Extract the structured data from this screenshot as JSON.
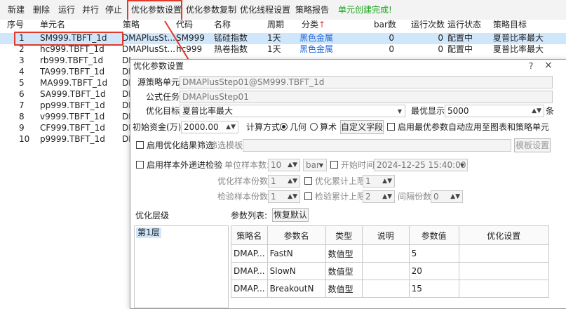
{
  "toolbar": {
    "items": [
      "新建",
      "删除",
      "运行",
      "并行",
      "停止",
      "优化参数设置",
      "优化参数复制",
      "优化线程设置",
      "策略报告"
    ],
    "status": "单元创建完成!"
  },
  "table": {
    "headers": [
      "序号",
      "单元名",
      "策略",
      "代码",
      "名称",
      "周期",
      "分类",
      "bar数",
      "运行次数",
      "运行状态",
      "策略目标"
    ],
    "header_mark": "↑",
    "rows": [
      {
        "no": "1",
        "name": "SM999.TBFT_1d",
        "strategy": "DMAPlusSt...",
        "code": "SM999",
        "cname": "锰硅指数",
        "period": "1天",
        "category": "黑色金属",
        "bars": "0",
        "runs": "0",
        "state": "配置中",
        "target": "夏普比率最大"
      },
      {
        "no": "2",
        "name": "hc999.TBFT_1d",
        "strategy": "DMAPlusSt...",
        "code": "hc999",
        "cname": "热卷指数",
        "period": "1天",
        "category": "黑色金属",
        "bars": "0",
        "runs": "0",
        "state": "配置中",
        "target": "夏普比率最大"
      },
      {
        "no": "3",
        "name": "rb999.TBFT_1d",
        "strategy": "DI"
      },
      {
        "no": "4",
        "name": "TA999.TBFT_1d",
        "strategy": "DI"
      },
      {
        "no": "5",
        "name": "MA999.TBFT_1d",
        "strategy": "DI"
      },
      {
        "no": "6",
        "name": "SA999.TBFT_1d",
        "strategy": "DI"
      },
      {
        "no": "7",
        "name": "pp999.TBFT_1d",
        "strategy": "DI"
      },
      {
        "no": "8",
        "name": "v9999.TBFT_1d",
        "strategy": "DI"
      },
      {
        "no": "9",
        "name": "CF999.TBFT_1d",
        "strategy": "DI"
      },
      {
        "no": "10",
        "name": "p9999.TBFT_1d",
        "strategy": "DI"
      }
    ]
  },
  "dialog": {
    "title": "优化参数设置",
    "help_icon": "?",
    "close_icon": "×",
    "source_label": "源策略单元:",
    "source_value": "DMAPlusStep01@SM999.TBFT_1d",
    "formula_label": "公式任务:",
    "formula_value": "DMAPlusStep01",
    "target_label": "优化目标:",
    "target_value": "夏普比率最大",
    "best_show_label": "最优显示:",
    "best_show_value": "5000",
    "best_show_unit": "条",
    "capital_label": "初始资金(万):",
    "capital_value": "2000.00",
    "calc_label": "计算方式:",
    "calc_geo": "几何",
    "calc_arith": "算术",
    "custom_field_btn": "自定义字段",
    "auto_apply_label": "启用最优参数自动应用至图表和策略单元",
    "filter_enable_label": "启用优化结果筛选",
    "filter_template_label": "筛选模板:",
    "template_btn": "模板设置",
    "oos_label": "启用样本外递进检验",
    "unit_sample_label": "单位样本数:",
    "unit_sample_value": "10",
    "unit_sample_type": "bar",
    "start_time_label": "开始时间",
    "start_time_value": "2024-12-25 15:40:00",
    "opt_copies_label": "优化样本份数:",
    "opt_copies_value": "1",
    "opt_cum_label": "优化累计上限",
    "opt_cum_value": "1",
    "check_copies_label": "检验样本份数:",
    "check_copies_value": "1",
    "check_cum_label": "检验累计上限",
    "check_cum_value": "2",
    "interval_label": "间隔份数:",
    "interval_value": "0",
    "layer_label": "优化层级",
    "layer_item": "第1层",
    "param_list_label": "参数列表:",
    "restore_btn": "恢复默认",
    "param_headers": [
      "策略名",
      "参数名",
      "类型",
      "说明",
      "参数值",
      "优化设置"
    ],
    "params": [
      {
        "strategy": "DMAP...",
        "name": "FastN",
        "type": "数值型",
        "desc": "",
        "value": "5",
        "opt": ""
      },
      {
        "strategy": "DMAP...",
        "name": "SlowN",
        "type": "数值型",
        "desc": "",
        "value": "20",
        "opt": ""
      },
      {
        "strategy": "DMAP...",
        "name": "BreakoutN",
        "type": "数值型",
        "desc": "",
        "value": "15",
        "opt": ""
      }
    ]
  },
  "colors": {
    "accent_red": "#e03a2a",
    "selection": "#cfe6fb",
    "status_green": "#1aa51a",
    "link_blue": "#1e66d8"
  }
}
